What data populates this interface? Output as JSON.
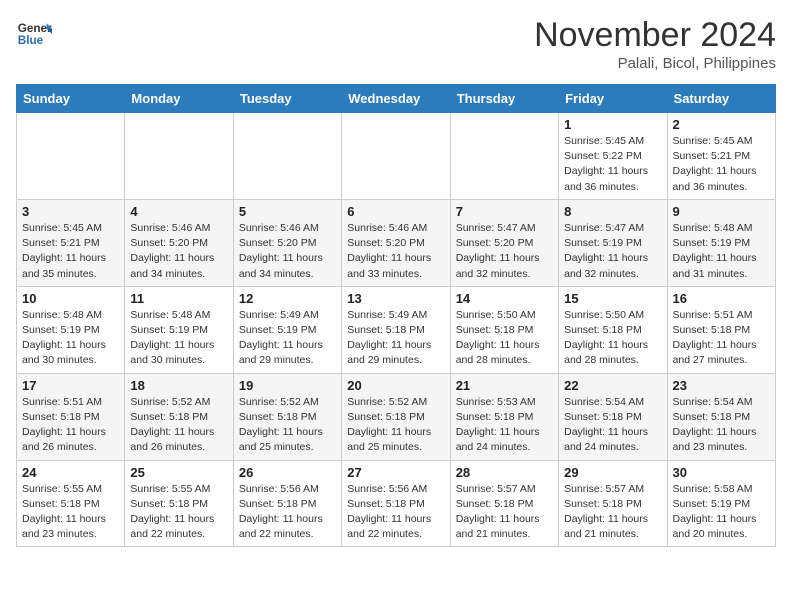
{
  "header": {
    "logo_line1": "General",
    "logo_line2": "Blue",
    "month": "November 2024",
    "location": "Palali, Bicol, Philippines"
  },
  "weekdays": [
    "Sunday",
    "Monday",
    "Tuesday",
    "Wednesday",
    "Thursday",
    "Friday",
    "Saturday"
  ],
  "weeks": [
    [
      {
        "day": "",
        "info": ""
      },
      {
        "day": "",
        "info": ""
      },
      {
        "day": "",
        "info": ""
      },
      {
        "day": "",
        "info": ""
      },
      {
        "day": "",
        "info": ""
      },
      {
        "day": "1",
        "info": "Sunrise: 5:45 AM\nSunset: 5:22 PM\nDaylight: 11 hours\nand 36 minutes."
      },
      {
        "day": "2",
        "info": "Sunrise: 5:45 AM\nSunset: 5:21 PM\nDaylight: 11 hours\nand 36 minutes."
      }
    ],
    [
      {
        "day": "3",
        "info": "Sunrise: 5:45 AM\nSunset: 5:21 PM\nDaylight: 11 hours\nand 35 minutes."
      },
      {
        "day": "4",
        "info": "Sunrise: 5:46 AM\nSunset: 5:20 PM\nDaylight: 11 hours\nand 34 minutes."
      },
      {
        "day": "5",
        "info": "Sunrise: 5:46 AM\nSunset: 5:20 PM\nDaylight: 11 hours\nand 34 minutes."
      },
      {
        "day": "6",
        "info": "Sunrise: 5:46 AM\nSunset: 5:20 PM\nDaylight: 11 hours\nand 33 minutes."
      },
      {
        "day": "7",
        "info": "Sunrise: 5:47 AM\nSunset: 5:20 PM\nDaylight: 11 hours\nand 32 minutes."
      },
      {
        "day": "8",
        "info": "Sunrise: 5:47 AM\nSunset: 5:19 PM\nDaylight: 11 hours\nand 32 minutes."
      },
      {
        "day": "9",
        "info": "Sunrise: 5:48 AM\nSunset: 5:19 PM\nDaylight: 11 hours\nand 31 minutes."
      }
    ],
    [
      {
        "day": "10",
        "info": "Sunrise: 5:48 AM\nSunset: 5:19 PM\nDaylight: 11 hours\nand 30 minutes."
      },
      {
        "day": "11",
        "info": "Sunrise: 5:48 AM\nSunset: 5:19 PM\nDaylight: 11 hours\nand 30 minutes."
      },
      {
        "day": "12",
        "info": "Sunrise: 5:49 AM\nSunset: 5:19 PM\nDaylight: 11 hours\nand 29 minutes."
      },
      {
        "day": "13",
        "info": "Sunrise: 5:49 AM\nSunset: 5:18 PM\nDaylight: 11 hours\nand 29 minutes."
      },
      {
        "day": "14",
        "info": "Sunrise: 5:50 AM\nSunset: 5:18 PM\nDaylight: 11 hours\nand 28 minutes."
      },
      {
        "day": "15",
        "info": "Sunrise: 5:50 AM\nSunset: 5:18 PM\nDaylight: 11 hours\nand 28 minutes."
      },
      {
        "day": "16",
        "info": "Sunrise: 5:51 AM\nSunset: 5:18 PM\nDaylight: 11 hours\nand 27 minutes."
      }
    ],
    [
      {
        "day": "17",
        "info": "Sunrise: 5:51 AM\nSunset: 5:18 PM\nDaylight: 11 hours\nand 26 minutes."
      },
      {
        "day": "18",
        "info": "Sunrise: 5:52 AM\nSunset: 5:18 PM\nDaylight: 11 hours\nand 26 minutes."
      },
      {
        "day": "19",
        "info": "Sunrise: 5:52 AM\nSunset: 5:18 PM\nDaylight: 11 hours\nand 25 minutes."
      },
      {
        "day": "20",
        "info": "Sunrise: 5:52 AM\nSunset: 5:18 PM\nDaylight: 11 hours\nand 25 minutes."
      },
      {
        "day": "21",
        "info": "Sunrise: 5:53 AM\nSunset: 5:18 PM\nDaylight: 11 hours\nand 24 minutes."
      },
      {
        "day": "22",
        "info": "Sunrise: 5:54 AM\nSunset: 5:18 PM\nDaylight: 11 hours\nand 24 minutes."
      },
      {
        "day": "23",
        "info": "Sunrise: 5:54 AM\nSunset: 5:18 PM\nDaylight: 11 hours\nand 23 minutes."
      }
    ],
    [
      {
        "day": "24",
        "info": "Sunrise: 5:55 AM\nSunset: 5:18 PM\nDaylight: 11 hours\nand 23 minutes."
      },
      {
        "day": "25",
        "info": "Sunrise: 5:55 AM\nSunset: 5:18 PM\nDaylight: 11 hours\nand 22 minutes."
      },
      {
        "day": "26",
        "info": "Sunrise: 5:56 AM\nSunset: 5:18 PM\nDaylight: 11 hours\nand 22 minutes."
      },
      {
        "day": "27",
        "info": "Sunrise: 5:56 AM\nSunset: 5:18 PM\nDaylight: 11 hours\nand 22 minutes."
      },
      {
        "day": "28",
        "info": "Sunrise: 5:57 AM\nSunset: 5:18 PM\nDaylight: 11 hours\nand 21 minutes."
      },
      {
        "day": "29",
        "info": "Sunrise: 5:57 AM\nSunset: 5:18 PM\nDaylight: 11 hours\nand 21 minutes."
      },
      {
        "day": "30",
        "info": "Sunrise: 5:58 AM\nSunset: 5:19 PM\nDaylight: 11 hours\nand 20 minutes."
      }
    ]
  ]
}
